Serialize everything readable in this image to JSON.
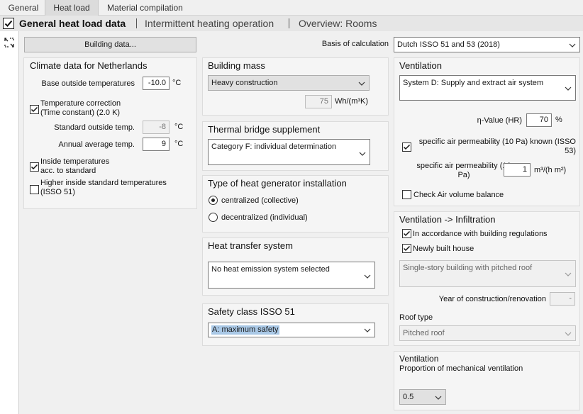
{
  "tabs": [
    {
      "label": "General",
      "active": false
    },
    {
      "label": "Heat load",
      "active": true
    },
    {
      "label": "Material compilation",
      "active": false
    }
  ],
  "subtabs": [
    {
      "label": "General heat load data",
      "active": true
    },
    {
      "label": "Intermittent heating operation",
      "active": false
    },
    {
      "label": "Overview: Rooms",
      "active": false
    }
  ],
  "toolbar": {
    "building_data_label": "Building data...",
    "basis_label": "Basis of calculation",
    "basis_value": "Dutch ISSO 51 and 53 (2018)"
  },
  "climate": {
    "title": "Climate data for Netherlands",
    "base_outside_label": "Base outside temperatures",
    "base_outside_value": "-10.0",
    "base_outside_unit": "°C",
    "temp_correction_label_1": "Temperature correction",
    "temp_correction_label_2": "(Time constant) (2.0 K)",
    "temp_correction_checked": true,
    "std_outside_label": "Standard outside temp.",
    "std_outside_value": "-8",
    "std_outside_unit": "°C",
    "annual_avg_label": "Annual average temp.",
    "annual_avg_value": "9",
    "annual_avg_unit": "°C",
    "inside_temps_label_1": "Inside temperatures",
    "inside_temps_label_2": "acc. to standard",
    "inside_temps_checked": true,
    "higher_inside_label_1": "Higher inside standard temperatures",
    "higher_inside_label_2": "(ISSO 51)",
    "higher_inside_checked": false
  },
  "building_mass": {
    "title": "Building mass",
    "value": "Heavy construction",
    "wh_value": "75",
    "wh_unit": "Wh/(m³K)"
  },
  "thermal_bridge": {
    "title": "Thermal bridge supplement",
    "value": "Category F: individual determination"
  },
  "heat_generator": {
    "title": "Type of heat generator installation",
    "option_centralized": "centralized (collective)",
    "option_decentralized": "decentralized (individual)",
    "selected": "centralized"
  },
  "heat_transfer": {
    "title": "Heat transfer system",
    "value": "No heat emission system selected"
  },
  "safety": {
    "title": "Safety class ISSO 51",
    "value": "A: maximum safety"
  },
  "ventilation": {
    "title": "Ventilation",
    "system_value": "System D: Supply and extract air system",
    "eta_label": "η-Value (HR)",
    "eta_value": "70",
    "eta_unit": "%",
    "air_perm_known_label": "specific air permeability (10 Pa) known (ISSO 53)",
    "air_perm_known_checked": true,
    "air_perm_label": "specific air permeability (10 Pa)",
    "air_perm_value": "1",
    "air_perm_unit": "m³/(h m²)",
    "check_balance_label": "Check Air volume balance",
    "check_balance_checked": false
  },
  "infiltration": {
    "title": "Ventilation -> Infiltration",
    "regulations_label": "In accordance with building regulations",
    "regulations_checked": true,
    "newly_built_label": "Newly built house",
    "newly_built_checked": true,
    "building_type_value": "Single-story building with pitched roof",
    "year_label": "Year of construction/renovation",
    "year_value": "-",
    "roof_type_label": "Roof type",
    "roof_type_value": "Pitched roof"
  },
  "mech_vent": {
    "title": "Ventilation",
    "subtitle": "Proportion of mechanical ventilation",
    "value": "0.5"
  }
}
